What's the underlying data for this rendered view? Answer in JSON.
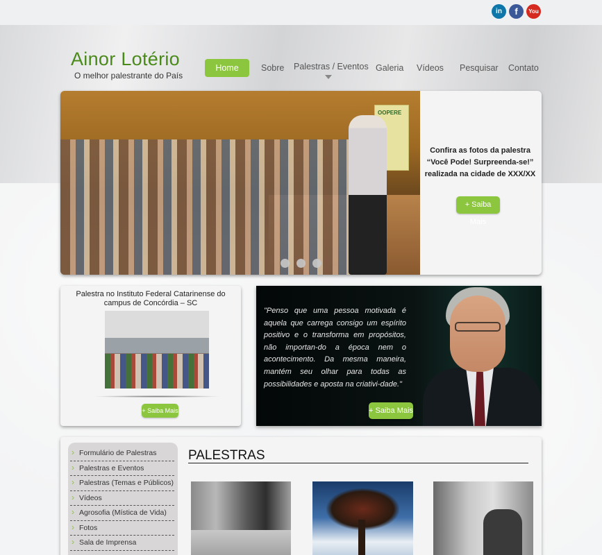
{
  "social": [
    {
      "icon": "linkedin-icon",
      "glyph": "in",
      "color": "#0e76a8"
    },
    {
      "icon": "facebook-icon",
      "glyph": "f",
      "color": "#3b5998"
    },
    {
      "icon": "youtube-icon",
      "glyph": "You",
      "color": "#d42a20"
    }
  ],
  "brand": {
    "title": "Ainor Lotério",
    "subtitle": "O melhor palestrante do País",
    "accent": "#8cc63f"
  },
  "nav": {
    "home": "Home",
    "sobre": "Sobre",
    "palestras": "Palestras / Eventos",
    "galeria": "Galeria",
    "videos": "Vídeos",
    "pesquisar": "Pesquisar",
    "contato": "Contato"
  },
  "slider": {
    "line1": "Confira as fotos da palestra",
    "line2": "“Você Pode! Surpreenda-se!”",
    "line3": "realizada na cidade de XXX/XX",
    "button": "+ Saiba Mais",
    "banner_text": "OOPERE"
  },
  "event_card": {
    "title": "Palestra no Instituto Federal Catarinense do campus de Concórdia – SC",
    "button": "+ Saiba Mais"
  },
  "quote_card": {
    "quote": "\"Penso que uma pessoa motivada é aquela que carrega consigo um espírito positivo e o transforma em propósitos, não importan-do a época nem o acontecimento. Da mesma maneira, mantém seu olhar para todas as possibilidades e aposta na criativi-dade.\"",
    "button": "+ Saiba Mais"
  },
  "sidebar": {
    "items": [
      "Formulário de Palestras",
      "Palestras e Eventos",
      "Palestras (Temas e Públicos)",
      "Vídeos",
      "Agrosofia (Mística de Vida)",
      "Fotos",
      "Sala de Imprensa"
    ]
  },
  "palestras": {
    "title": "PALESTRAS"
  }
}
